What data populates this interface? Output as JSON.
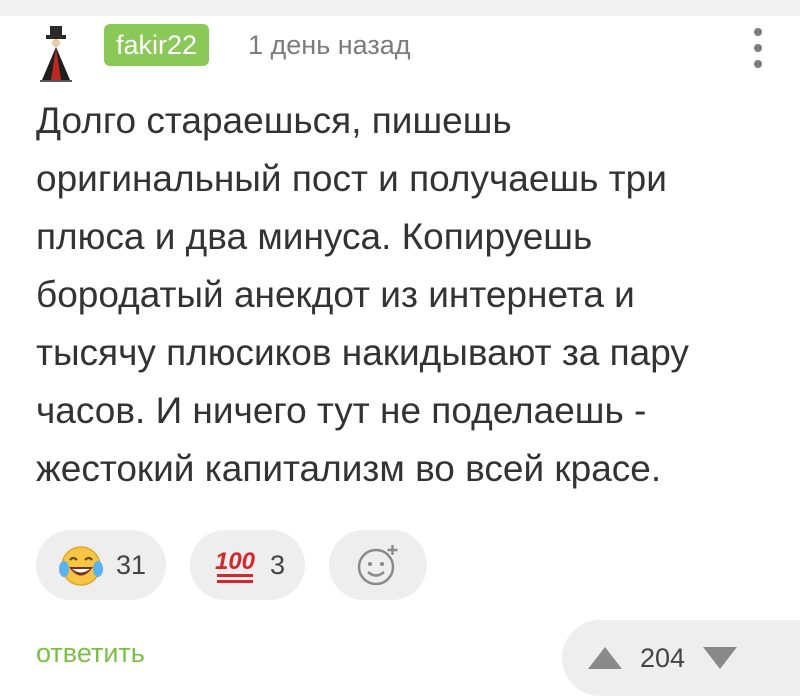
{
  "comment": {
    "author": "fakir22",
    "time": "1 день назад",
    "text": "Долго стараешься, пишешь\nоригинальный пост и получаешь три\nплюса и два минуса. Копируешь\nбородатый анекдот из интернета и\nтысячу плюсиков накидывают за пару\nчасов. И ничего тут не поделаешь -\nжестокий капитализм во всей красе.",
    "reactions": [
      {
        "icon": "laughing-tears-emoji-icon",
        "count": "31"
      },
      {
        "icon": "hundred-points-emoji-icon",
        "count": "3"
      }
    ],
    "add_reaction_icon": "add-emoji-icon",
    "reply_label": "ответить",
    "rating": "204",
    "colors": {
      "username_bg": "#8ac858",
      "reply": "#7bbf46",
      "hundred_red": "#d9262c"
    }
  }
}
